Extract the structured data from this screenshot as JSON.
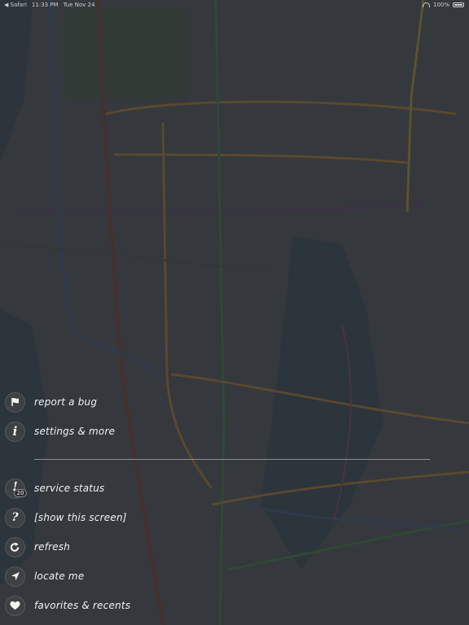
{
  "status_bar": {
    "back_app": "◀ Safari",
    "time": "11:33 PM",
    "date": "Tue Nov 24",
    "battery": "100%"
  },
  "menu": {
    "top_items": [
      {
        "id": "report-bug",
        "label": "report a bug",
        "icon": "flag-icon"
      },
      {
        "id": "settings",
        "label": "settings & more",
        "icon": "info-icon"
      }
    ],
    "bottom_items": [
      {
        "id": "service-status",
        "label": "service status",
        "icon": "exclamation-icon",
        "badge": "20"
      },
      {
        "id": "show-screen",
        "label": "[show this screen]",
        "icon": "question-icon"
      },
      {
        "id": "refresh",
        "label": "refresh",
        "icon": "refresh-icon"
      },
      {
        "id": "locate-me",
        "label": "locate me",
        "icon": "location-arrow-icon"
      },
      {
        "id": "favorites",
        "label": "favorites & recents",
        "icon": "heart-icon"
      }
    ]
  },
  "colors": {
    "line_orange": "#c97a2a",
    "line_green": "#2e9a4e",
    "line_red": "#c33a3a",
    "line_blue": "#2f5fb0",
    "line_purple": "#8a3fa0",
    "line_yellow": "#c9b52a"
  }
}
